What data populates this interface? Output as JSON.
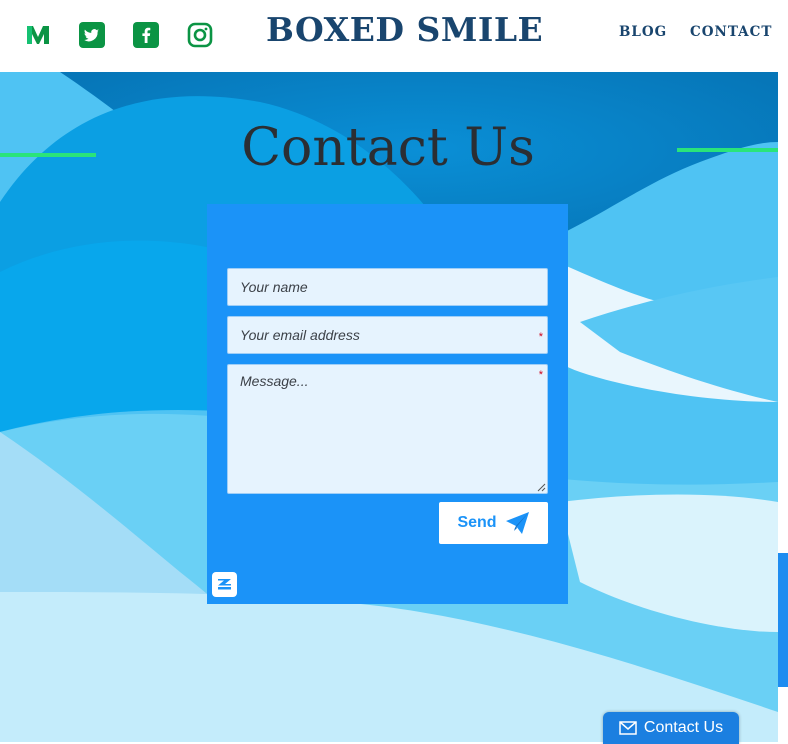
{
  "header": {
    "brand": "BOXED SMILE",
    "social": [
      {
        "icon": "medium-icon"
      },
      {
        "icon": "twitter-icon"
      },
      {
        "icon": "facebook-icon"
      },
      {
        "icon": "instagram-icon"
      }
    ],
    "nav": {
      "blog": "BLOG",
      "contact": "CONTACT"
    }
  },
  "hero": {
    "heading": "Contact Us"
  },
  "form": {
    "name_placeholder": "Your name",
    "email_placeholder": "Your email address",
    "message_placeholder": "Message...",
    "required_marker": "*",
    "send_label": "Send",
    "send_icon": "paper-plane-icon",
    "badge_icon": "zoho-forms-icon"
  },
  "floating_button": {
    "label": "Contact Us",
    "icon": "envelope-icon"
  },
  "colors": {
    "brand": "#19456e",
    "social_green": "#0b9444",
    "accent_line": "#2ae47a",
    "form_panel": "#1b93f8",
    "floating_button": "#1b7fe0"
  }
}
